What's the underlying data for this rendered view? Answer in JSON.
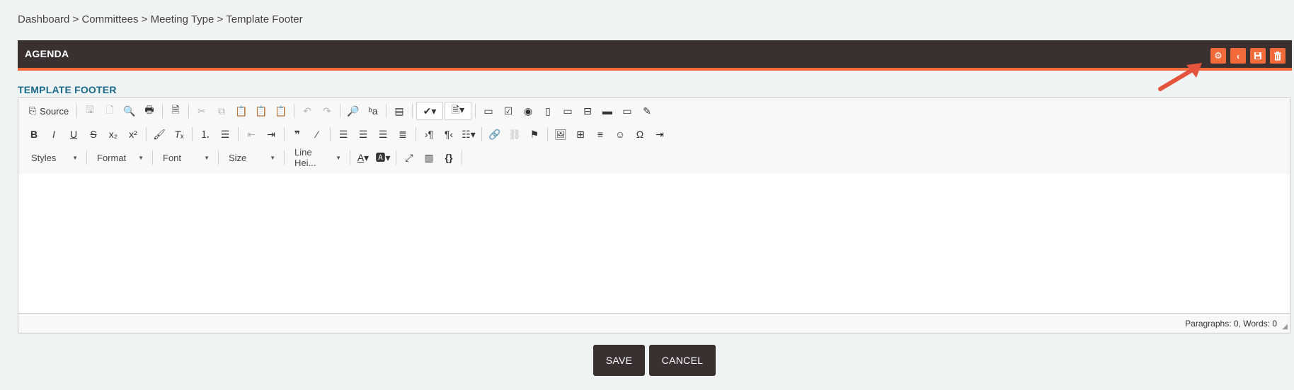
{
  "breadcrumb": "Dashboard > Committees > Meeting Type > Template Footer",
  "panel": {
    "title": "AGENDA"
  },
  "section_label": "TEMPLATE FOOTER",
  "toolbar": {
    "source_label": "Source",
    "combos": {
      "styles": "Styles",
      "format": "Format",
      "font": "Font",
      "size": "Size",
      "line_height": "Line Hei..."
    }
  },
  "status": "Paragraphs: 0, Words: 0",
  "buttons": {
    "save": "SAVE",
    "cancel": "CANCEL"
  },
  "colors": {
    "header_bg": "#3a302f",
    "accent": "#f26a3a",
    "section_label": "#1c6a8a"
  }
}
